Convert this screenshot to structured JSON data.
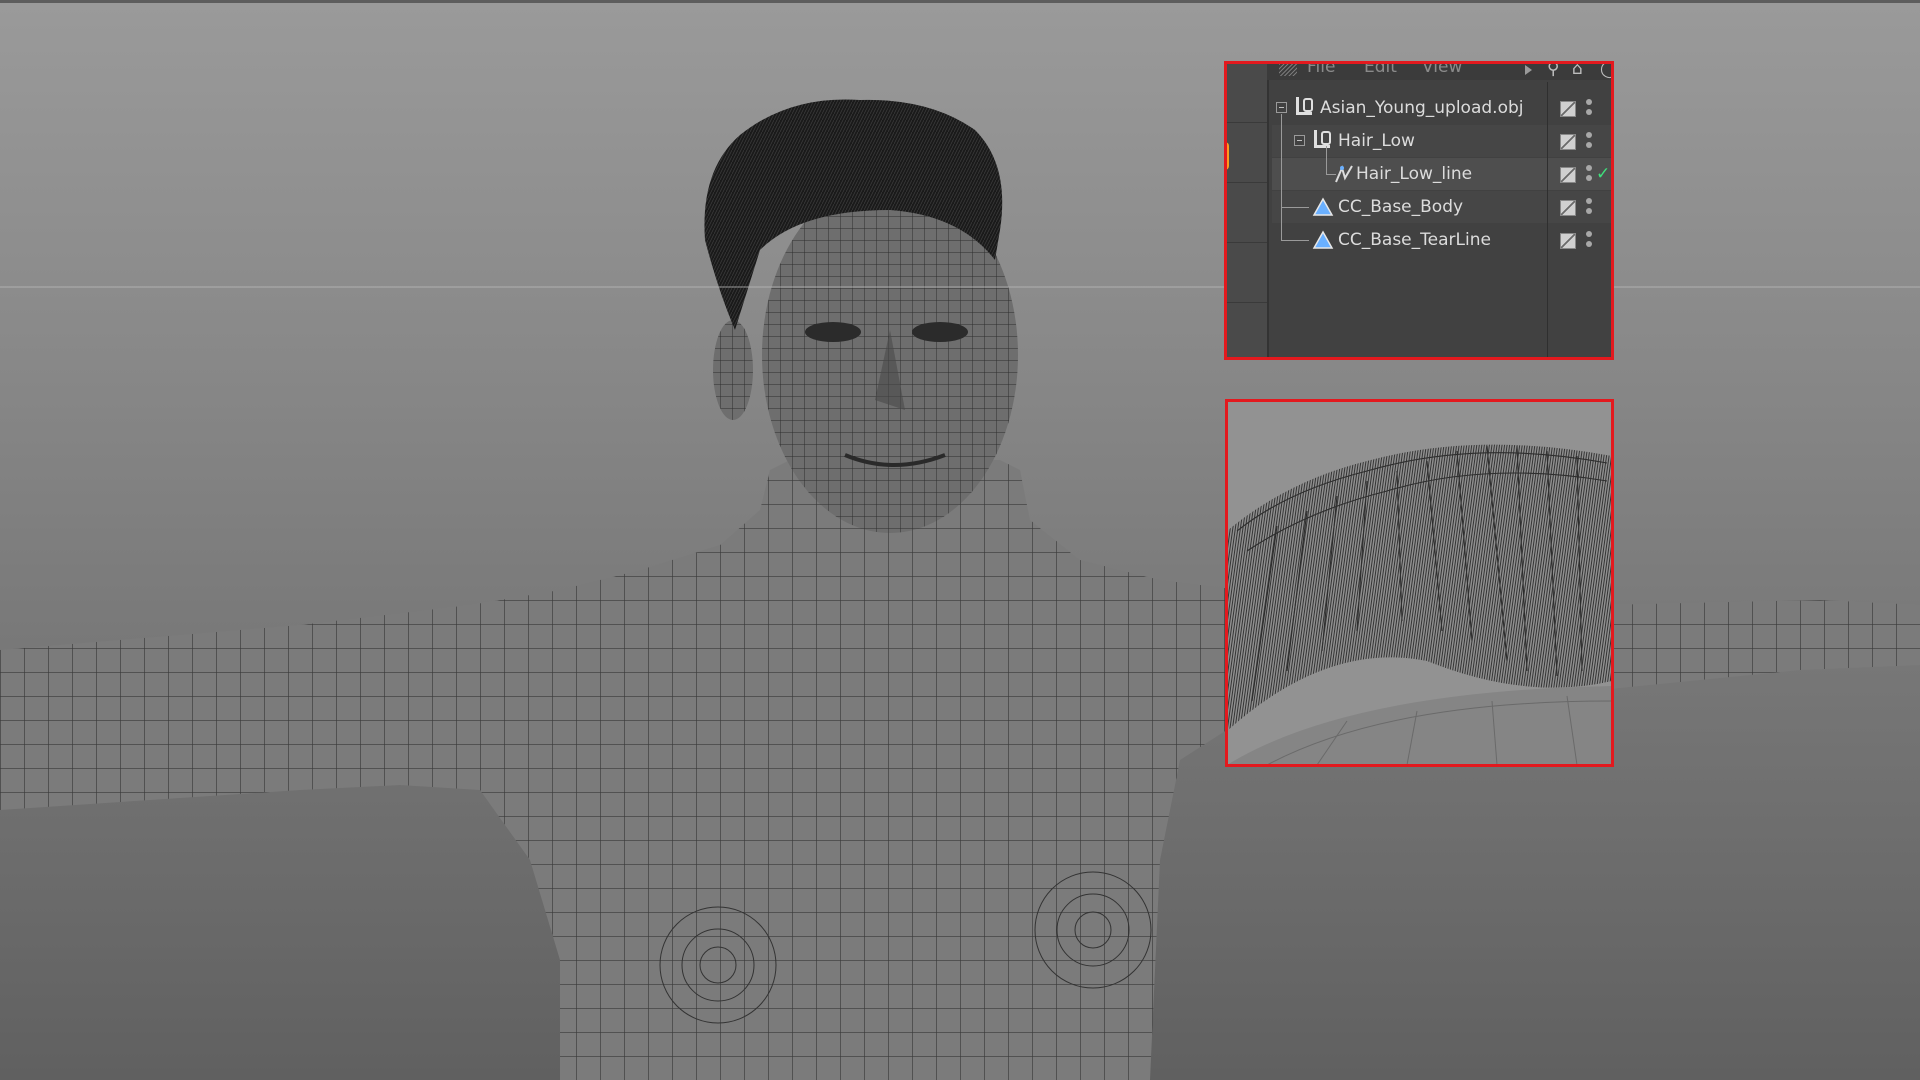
{
  "viewport": {
    "background_top": "#9a9a9a",
    "background_bottom": "#606060",
    "subject": "3D wireframe human model with hair"
  },
  "object_manager": {
    "menu": [
      "File",
      "Edit",
      "View"
    ],
    "toolbar_icons": [
      "search-icon",
      "tag-icon",
      "eye-icon"
    ],
    "highlight_color": "#e3191e",
    "items": [
      {
        "label": "Asian_Young_upload.obj",
        "type": "null",
        "level": 0,
        "expanded": true
      },
      {
        "label": "Hair_Low",
        "type": "null",
        "level": 1,
        "expanded": true
      },
      {
        "label": "Hair_Low_line",
        "type": "spline",
        "level": 2,
        "checked": true
      },
      {
        "label": "CC_Base_Body",
        "type": "polygon",
        "level": 1
      },
      {
        "label": "CC_Base_TearLine",
        "type": "polygon",
        "level": 1
      }
    ]
  },
  "inset": {
    "subject": "close-up of hair guide lines"
  }
}
